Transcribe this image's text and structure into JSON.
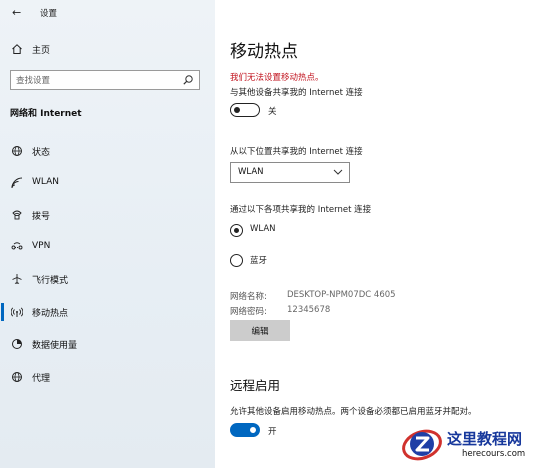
{
  "window": {
    "title": "设置"
  },
  "sidebar": {
    "home_label": "主页",
    "search_placeholder": "查找设置",
    "section_title": "网络和 Internet",
    "items": [
      {
        "label": "状态",
        "icon": "globe-icon"
      },
      {
        "label": "WLAN",
        "icon": "wifi-icon"
      },
      {
        "label": "拨号",
        "icon": "phone-icon"
      },
      {
        "label": "VPN",
        "icon": "vpn-icon"
      },
      {
        "label": "飞行模式",
        "icon": "airplane-icon"
      },
      {
        "label": "移动热点",
        "icon": "hotspot-icon",
        "active": true
      },
      {
        "label": "数据使用量",
        "icon": "data-usage-icon"
      },
      {
        "label": "代理",
        "icon": "globe-icon"
      }
    ]
  },
  "main": {
    "title": "移动热点",
    "error": "我们无法设置移动热点。",
    "share_label": "与其他设备共享我的 Internet 连接",
    "share_toggle": {
      "state": "关",
      "on": false
    },
    "from_label": "从以下位置共享我的 Internet 连接",
    "from_select": "WLAN",
    "via_label": "通过以下各项共享我的 Internet 连接",
    "via_options": [
      {
        "label": "WLAN",
        "checked": true
      },
      {
        "label": "蓝牙",
        "checked": false
      }
    ],
    "network_name_key": "网络名称:",
    "network_name_value": "DESKTOP-NPM07DC 4605",
    "network_password_key": "网络密码:",
    "network_password_value": "12345678",
    "edit_label": "编辑",
    "remote_title": "远程启用",
    "remote_desc": "允许其他设备启用移动热点。两个设备必须都已启用蓝牙并配对。",
    "remote_toggle": {
      "state": "开",
      "on": true
    }
  },
  "watermark": {
    "title": "这里教程网",
    "url": "herecours.com"
  },
  "colors": {
    "accent": "#0067c0",
    "error": "#c1111c",
    "sidebar_bg": "#e9eff5"
  }
}
